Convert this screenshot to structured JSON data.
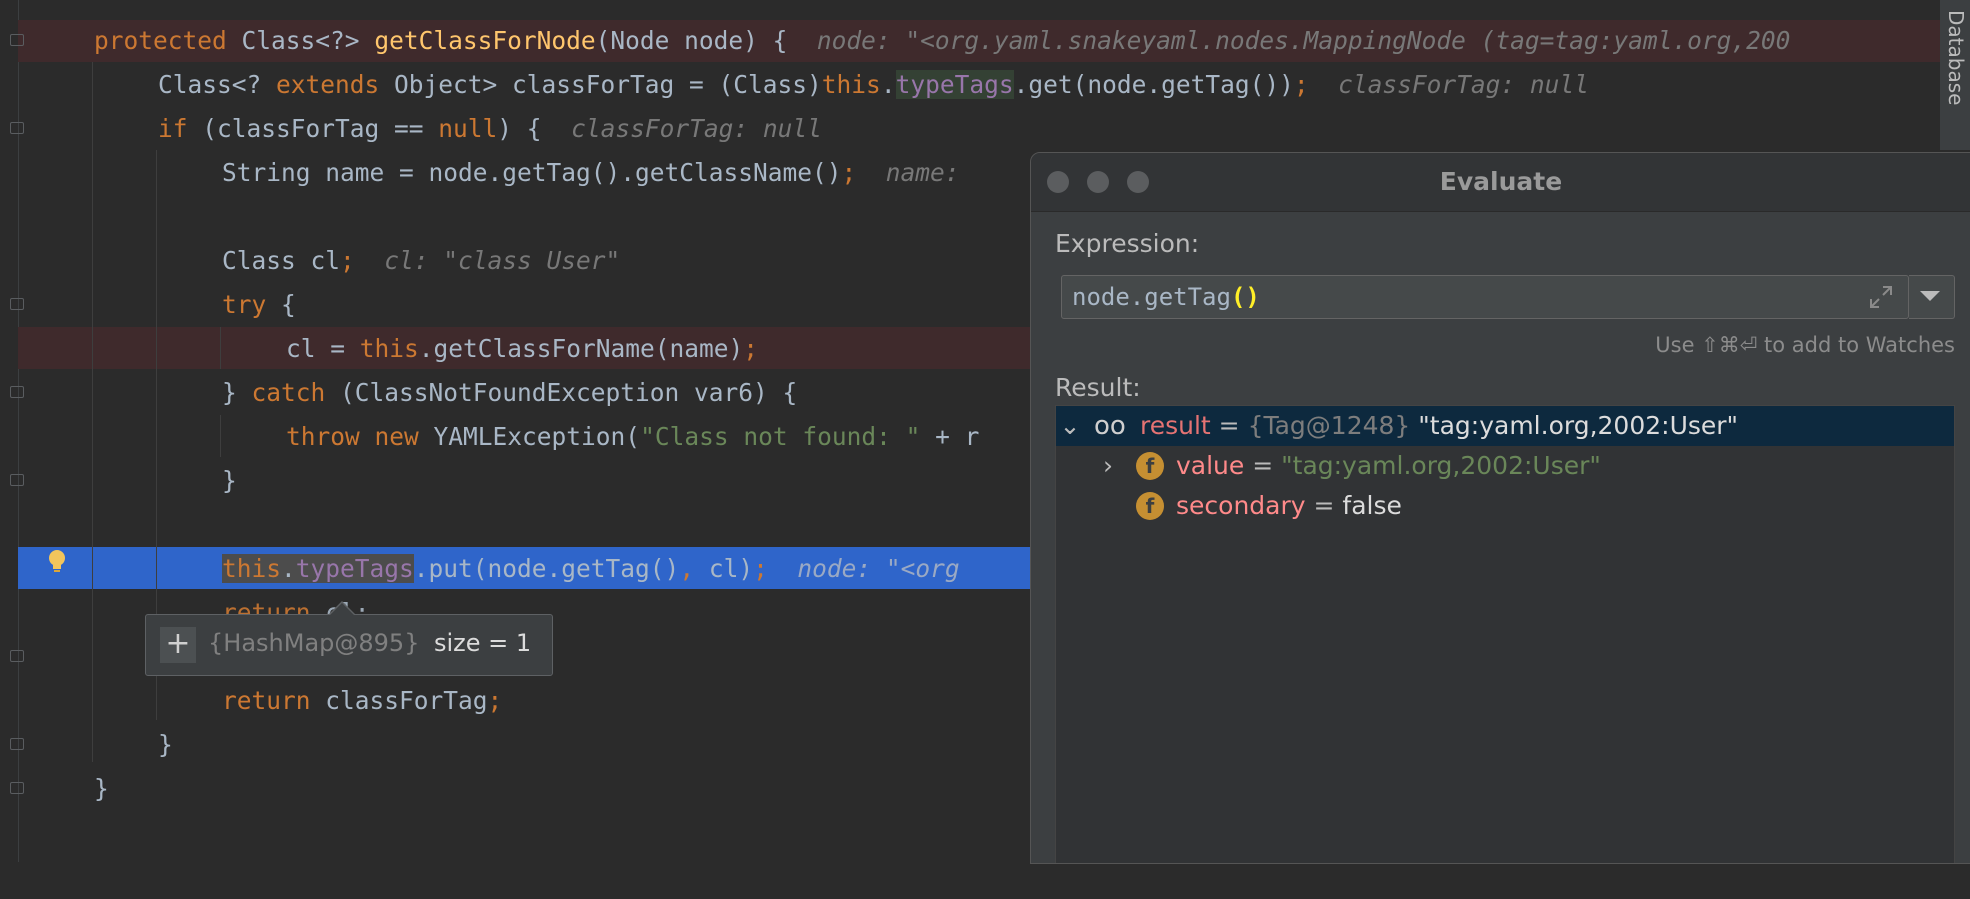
{
  "code": {
    "l1": {
      "kw": "protected",
      "type": "Class<?>",
      "fn": "getClassForNode",
      "args": "(Node node) {",
      "hint": "node: \"<org.yaml.snakeyaml.nodes.MappingNode (tag=tag:yaml.org,200"
    },
    "l2": {
      "a": "Class<? ",
      "kw": "extends",
      "b": " Object> classForTag = (Class)",
      "this": "this",
      "dot": ".",
      "fld": "typeTags",
      "c": ".get(node.getTag())",
      "semi": ";",
      "hint": "classForTag: null"
    },
    "l3": {
      "kw": "if",
      "a": " (classForTag == ",
      "kw2": "null",
      "b": ") {",
      "hint": "classForTag: null"
    },
    "l4": {
      "a": "String name = node.getTag().getClassName()",
      "semi": ";",
      "hint": "name:"
    },
    "l5": {
      "a": "Class cl",
      "semi": ";",
      "hint": "cl: \"class User\""
    },
    "l6": {
      "kw": "try",
      "a": " {"
    },
    "l7": {
      "a": "cl = ",
      "this": "this",
      "b": ".getClassForName(name)",
      "semi": ";"
    },
    "l8": {
      "a": "} ",
      "kw": "catch",
      "b": " (ClassNotFoundException var6) {"
    },
    "l9": {
      "kw": "throw",
      "kw2": "new",
      "a": " YAMLException(",
      "str": "\"Class not found: \"",
      "b": " + r"
    },
    "l10": {
      "a": "}"
    },
    "l11": {
      "this": "this",
      "dot": ".",
      "fld": "typeTags",
      "a": ".put(node.getTag()",
      "comma": ",",
      "b": " cl)",
      "semi": ";",
      "hint": "node: \"<org"
    },
    "l12": {
      "kw": "return",
      "a": " cl;"
    },
    "l13": {
      "kw": "return",
      "a": " classForTag",
      "semi": ";"
    },
    "l14": {
      "a": "}"
    },
    "l15": {
      "a": "}"
    }
  },
  "popup": {
    "plus": "+",
    "ref": "{HashMap@895}",
    "size": "size = 1"
  },
  "side_tab": {
    "label": "Database"
  },
  "dialog": {
    "title": "Evaluate",
    "expression_label": "Expression:",
    "expression_value_a": "node.getTag",
    "expression_value_b": "()",
    "watch_hint": "Use ⇧⌘⏎ to add to Watches",
    "result_label": "Result:",
    "tree": [
      {
        "name": "result",
        "eq": " = ",
        "ref": "{Tag@1248}",
        "value": "\"tag:yaml.org,2002:User\""
      },
      {
        "name": "value",
        "eq": " = ",
        "value": "\"tag:yaml.org,2002:User\""
      },
      {
        "name": "secondary",
        "eq": " = ",
        "value": "false"
      }
    ]
  },
  "colors": {
    "keyword": "#cc7832",
    "method": "#ffc66d",
    "field": "#9876aa",
    "string": "#6a8759",
    "current_line": "#2f65ca",
    "error_line": "#3f2a2c"
  }
}
